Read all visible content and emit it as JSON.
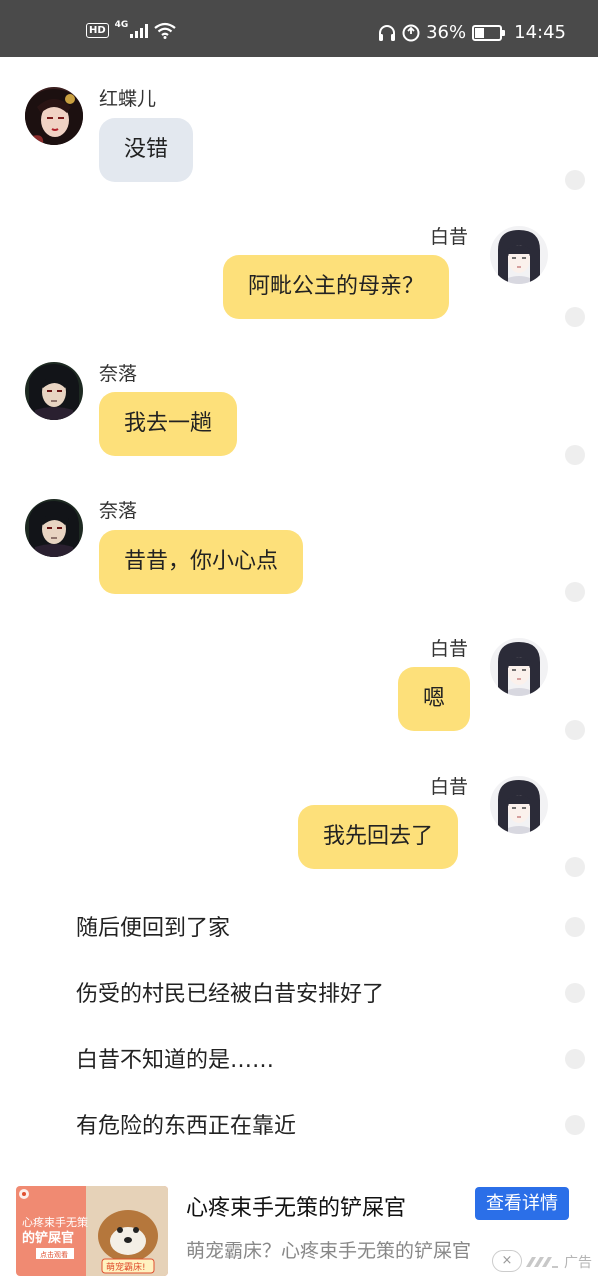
{
  "status_bar": {
    "hd": "HD",
    "network": "4G",
    "battery_percent": "36%",
    "battery_level": 0.36,
    "time": "14:45",
    "icons": [
      "headset-icon",
      "data-saver-icon",
      "wifi-icon",
      "signal-icon",
      "battery-icon"
    ]
  },
  "chat": {
    "messages": [
      {
        "side": "left",
        "sender": "红蝶儿",
        "text": "没错",
        "bubble_color": "#e3e8ef",
        "avatar": "hongdieer-avatar"
      },
      {
        "side": "right",
        "sender": "白昔",
        "text": "阿毗公主的母亲？",
        "bubble_color": "#fde07a",
        "avatar": "baixi-avatar"
      },
      {
        "side": "left",
        "sender": "奈落",
        "text": "我去一趟",
        "bubble_color": "#fde07a",
        "avatar": "naraku-avatar"
      },
      {
        "side": "left",
        "sender": "奈落",
        "text": "昔昔，你小心点",
        "bubble_color": "#fde07a",
        "avatar": "naraku-avatar"
      },
      {
        "side": "right",
        "sender": "白昔",
        "text": "嗯",
        "bubble_color": "#fde07a",
        "avatar": "baixi-avatar"
      },
      {
        "side": "right",
        "sender": "白昔",
        "text": "我先回去了",
        "bubble_color": "#fde07a",
        "avatar": "baixi-avatar"
      }
    ],
    "narration": [
      "随后便回到了家",
      "伤受的村民已经被白昔安排好了",
      "白昔不知道的是……",
      "有危险的东西正在靠近"
    ]
  },
  "ad": {
    "title": "心疼束手无策的铲屎官",
    "description": "萌宠霸床？心疼束手无策的铲屎官",
    "button": "查看详情",
    "tag": "广告",
    "close": "×",
    "thumb_text": [
      "心疼束手无策",
      "的铲屎官",
      "点击观看",
      "萌宠霸床!"
    ]
  }
}
